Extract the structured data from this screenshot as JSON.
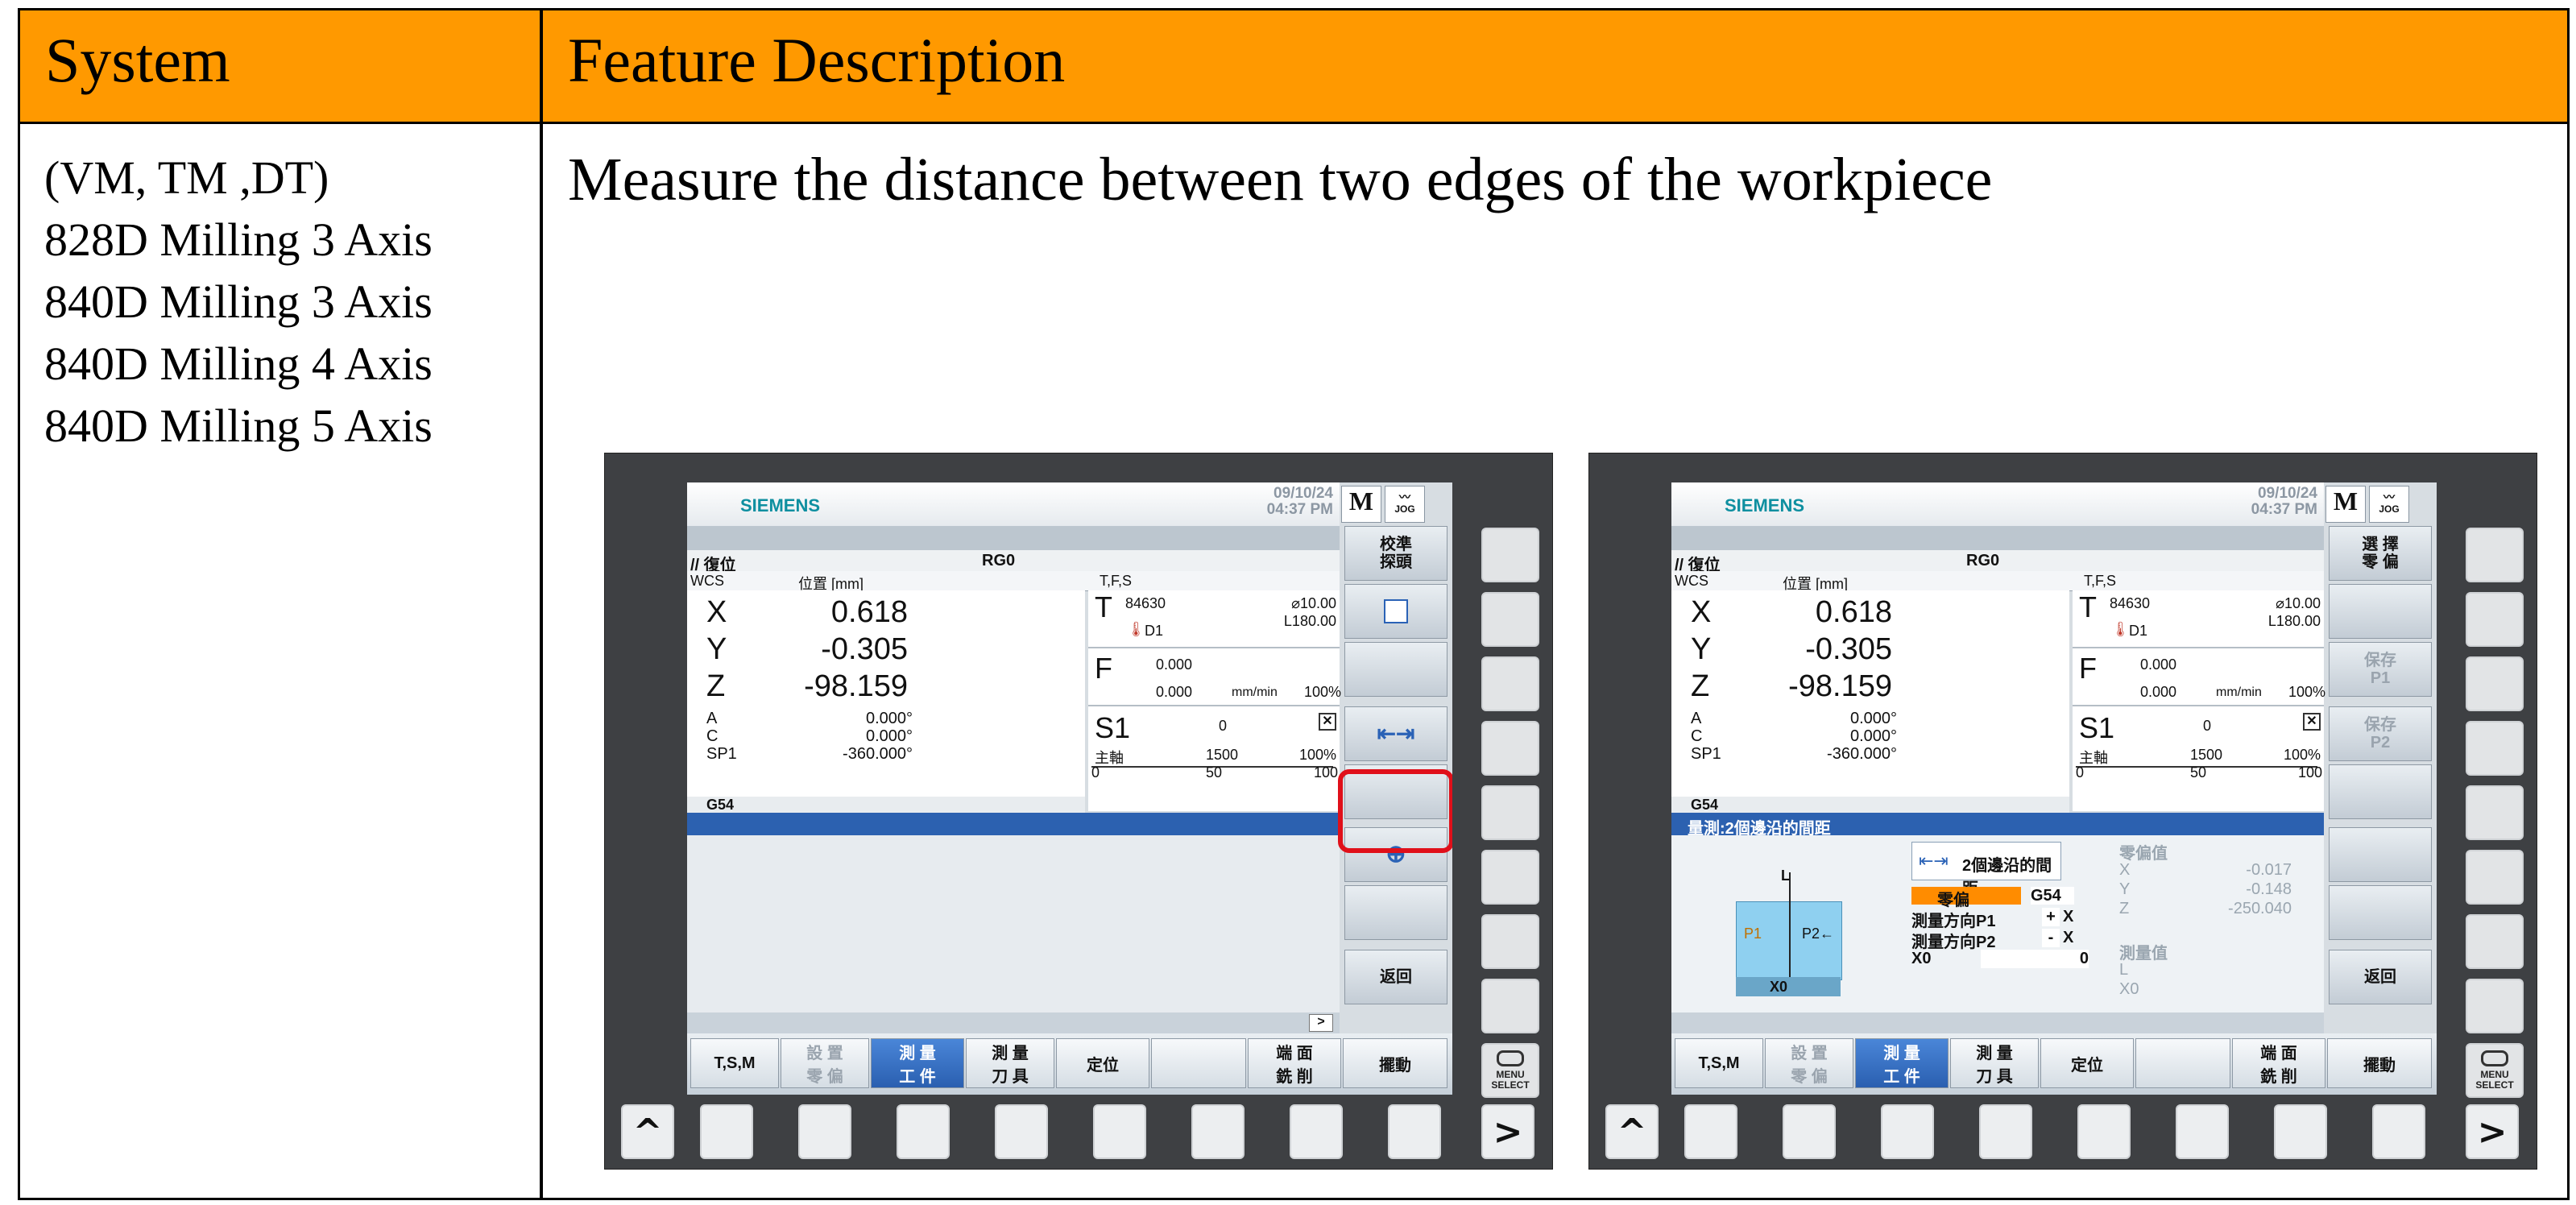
{
  "table": {
    "header_system": "System",
    "header_feature": "Feature Description",
    "systems": [
      "(VM, TM ,DT)",
      "828D Milling 3 Axis",
      "840D Milling 3 Axis",
      "840D Milling 4 Axis",
      "840D Milling 5 Axis"
    ],
    "description": "Measure the distance between two edges of the workpiece"
  },
  "hmi": {
    "brand": "SIEMENS",
    "date": "09/10/24",
    "time": "04:37 PM",
    "mode_m": "M",
    "mode_jog": "JOG",
    "reset_label": "// 復位",
    "program": "RG0",
    "wcs": "WCS",
    "pos_header": "位置 [mm]",
    "tfs_header": "T,F,S",
    "axes": [
      {
        "name": "X",
        "value": "0.618"
      },
      {
        "name": "Y",
        "value": "-0.305"
      },
      {
        "name": "Z",
        "value": "-98.159"
      }
    ],
    "aux_axes": [
      {
        "name": "A",
        "value": "0.000°"
      },
      {
        "name": "C",
        "value": "0.000°"
      },
      {
        "name": "SP1",
        "value": "-360.000°"
      }
    ],
    "work_offset": "G54",
    "tool": {
      "label": "T",
      "number": "84630",
      "diameter": "⌀10.00",
      "length": "L180.00",
      "d": "D1"
    },
    "feed": {
      "label": "F",
      "value1": "0.000",
      "value2": "0.000",
      "unit": "mm/min",
      "pct": "100%"
    },
    "spindle": {
      "label": "S1",
      "value": "0",
      "name": "主軸",
      "speed": "1500",
      "pct": "100%",
      "scale": [
        "0",
        "50",
        "100"
      ]
    },
    "h_softkeys": [
      "T,S,M",
      "設 置 零 偏",
      "測 量 工 件",
      "測 量 刀 具",
      "定位",
      "端 面 銑 削",
      "擺動"
    ],
    "h_softkeys_short": {
      "setzero_1": "設 置",
      "setzero_2": "零 偏",
      "meas_work_1": "測 量",
      "meas_work_2": "工 件",
      "meas_tool_1": "測 量",
      "meas_tool_2": "刀 具",
      "face_1": "端 面",
      "face_2": "銑 削"
    },
    "menu_select": [
      "MENU",
      "SELECT"
    ],
    "nav_left": "^",
    "nav_right": ">",
    "etc": ">"
  },
  "panel_left": {
    "v_softkeys": {
      "calibrate_1": "校準",
      "calibrate_2": "探頭",
      "back": "返回"
    }
  },
  "panel_right": {
    "v_softkeys": {
      "select_1": "選 擇",
      "select_2": "零 偏",
      "save_p1_1": "保存",
      "save_p1_2": "P1",
      "save_p2_1": "保存",
      "save_p2_2": "P2",
      "back": "返回"
    },
    "meas_title": "量測:2個邊沿的間距",
    "form_title": "2個邊沿的間距",
    "rows": [
      {
        "label": "零偏",
        "value": "G54"
      },
      {
        "label": "測量方向P1",
        "sign": "+",
        "axis": "X"
      },
      {
        "label": "測量方向P2",
        "sign": "-",
        "axis": "X"
      },
      {
        "label": "X0",
        "value": "0"
      }
    ],
    "zero_offset_title": "零偏值",
    "zero_offset": [
      {
        "axis": "X",
        "value": "-0.017"
      },
      {
        "axis": "Y",
        "value": "-0.148"
      },
      {
        "axis": "Z",
        "value": "-250.040"
      }
    ],
    "meas_values_title": "測量值",
    "meas_values": [
      "L",
      "X0"
    ],
    "diagram": {
      "l": "L",
      "p1": "P1",
      "p2": "P2←",
      "x0": "X0"
    }
  },
  "colors": {
    "header_orange": "#FF9900",
    "selection_blue": "#2C61B0",
    "highlight_red": "#E0101A",
    "brand_teal": "#0E8FA0",
    "field_orange": "#FF8C00"
  }
}
